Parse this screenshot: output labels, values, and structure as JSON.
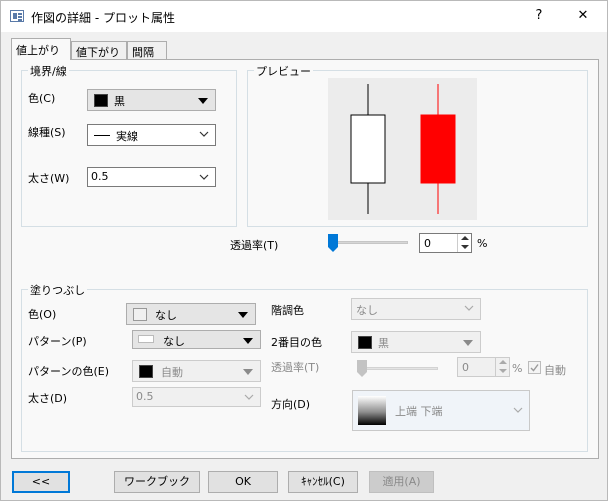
{
  "window": {
    "title": "作図の詳細 - プロット属性",
    "help": "?",
    "close": "✕"
  },
  "tabs": [
    {
      "label": "値上がり",
      "active": true
    },
    {
      "label": "値下がり",
      "active": false
    },
    {
      "label": "間隔",
      "active": false
    }
  ],
  "border_group": {
    "title": "境界/線",
    "color_label": "色(C)",
    "color_value": "黒",
    "color_hex": "#000000",
    "linetype_label": "線種(S)",
    "linetype_value": "実線",
    "width_label": "太さ(W)",
    "width_value": "0.5"
  },
  "preview": {
    "title": "プレビュー",
    "up_fill": "#ffffff",
    "down_fill": "#ff0000"
  },
  "transparency": {
    "label": "透過率(T)",
    "value": "0",
    "unit": "%",
    "level": 0
  },
  "fill_group": {
    "title": "塗りつぶし",
    "color_label": "色(O)",
    "color_value": "なし",
    "pattern_label": "パターン(P)",
    "pattern_value": "なし",
    "pattern_color_label": "パターンの色(E)",
    "pattern_color_value": "自動",
    "width_label": "太さ(D)",
    "width_value": "0.5",
    "gradient_label": "階調色",
    "gradient_value": "なし",
    "second_color_label": "2番目の色",
    "second_color_value": "黒",
    "transparency_label": "透過率(T)",
    "transparency_value": "0",
    "transparency_unit": "%",
    "auto_label": "自動",
    "direction_label": "方向(D)",
    "direction_value": "上端 下端"
  },
  "footer": {
    "collapse": "<<",
    "workbook": "ワークブック",
    "ok": "OK",
    "cancel": "ｷｬﾝｾﾙ(C)",
    "apply": "適用(A)"
  },
  "colors": {
    "accent": "#0078d7",
    "slider_thumb": "#0078d7"
  }
}
